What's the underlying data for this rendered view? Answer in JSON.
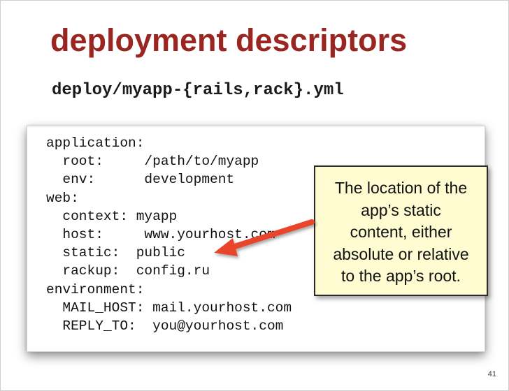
{
  "slide": {
    "title": "deployment descriptors",
    "subtitle": "deploy/myapp-{rails,rack}.yml",
    "code_lines": [
      "application:",
      "  root:     /path/to/myapp",
      "  env:      development",
      "web:",
      "  context: myapp",
      "  host:     www.yourhost.com",
      "  static:  public",
      "  rackup:  config.ru",
      "environment:",
      "  MAIL_HOST: mail.yourhost.com",
      "  REPLY_TO:  you@yourhost.com"
    ],
    "callout_lines": [
      "The location of the",
      "app’s static",
      "content, either",
      "absolute or relative",
      "to the app’s root."
    ],
    "page_number": "41"
  },
  "colors": {
    "title": "#9b2621",
    "arrow": "#e8452c",
    "callout_background": "#fefcd0"
  }
}
